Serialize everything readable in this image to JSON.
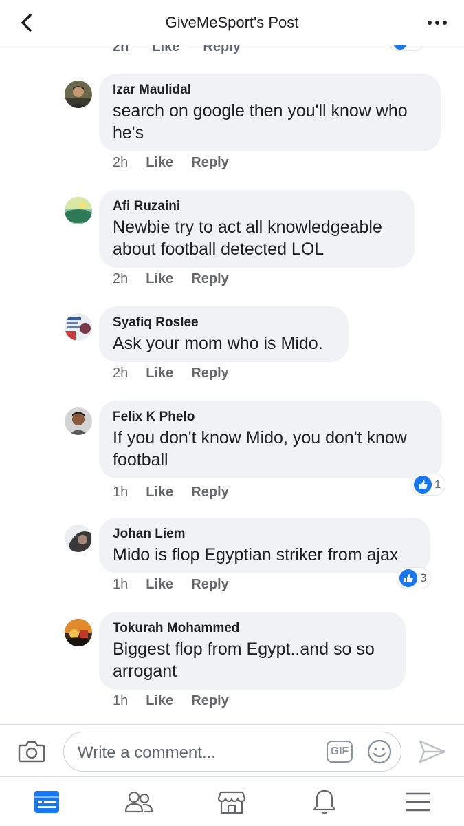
{
  "header": {
    "title": "GiveMeSport's Post"
  },
  "partial_row": {
    "time": "2h",
    "like": "Like",
    "reply": "Reply"
  },
  "comments": [
    {
      "name": "Izar Maulidal",
      "text": "search on google then you'll know who\nhe's",
      "time": "2h",
      "like": "Like",
      "reply": "Reply"
    },
    {
      "name": "Afi Ruzaini",
      "text": "Newbie try to act all knowledgeable\nabout football detected LOL",
      "time": "2h",
      "like": "Like",
      "reply": "Reply"
    },
    {
      "name": "Syafiq Roslee",
      "text": "Ask your mom who is Mido.",
      "time": "2h",
      "like": "Like",
      "reply": "Reply"
    },
    {
      "name": "Felix K Phelo",
      "text": "If you don't know Mido, you don't know\nfootball",
      "time": "1h",
      "like": "Like",
      "reply": "Reply",
      "reactions": "1"
    },
    {
      "name": "Johan Liem",
      "text": "Mido is flop Egyptian striker from ajax",
      "time": "1h",
      "like": "Like",
      "reply": "Reply",
      "reactions": "3"
    },
    {
      "name": "Tokurah Mohammed",
      "text": "Biggest flop from Egypt..and so so\narrogant",
      "time": "1h",
      "like": "Like",
      "reply": "Reply"
    }
  ],
  "composer": {
    "placeholder": "Write a comment...",
    "gif_label": "GIF"
  },
  "icons": {
    "back": "chevron-left-icon",
    "more": "more-dots-icon",
    "camera": "camera-icon",
    "emoji": "emoji-icon",
    "send": "send-icon",
    "like": "thumbs-up-icon",
    "tabs": [
      "news-feed-icon",
      "friends-icon",
      "marketplace-icon",
      "notifications-icon",
      "menu-icon"
    ]
  },
  "colors": {
    "accent": "#1877f2",
    "bubble": "#f0f2f5",
    "secondary_text": "#65676b"
  }
}
